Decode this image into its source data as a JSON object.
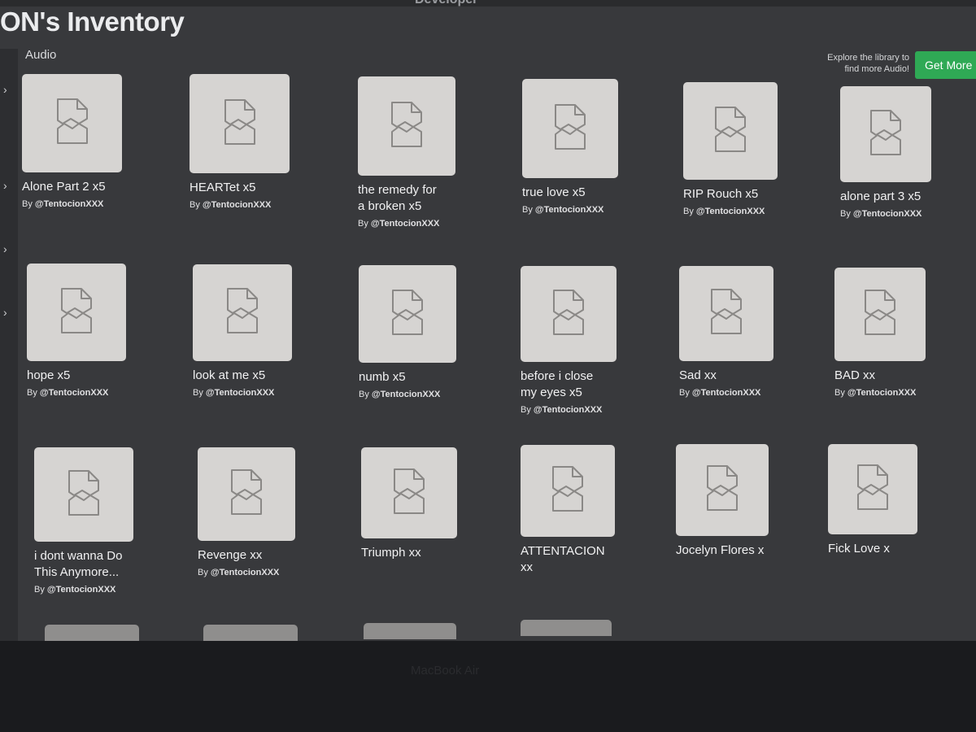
{
  "window": {
    "title_partial": "Developer"
  },
  "page": {
    "title": "ON's Inventory",
    "section": "Audio"
  },
  "promo": {
    "text": "Explore the library to find more Audio!",
    "button_label": "Get More"
  },
  "by_prefix": "By",
  "items": [
    {
      "name": "Alone Part 2 x5",
      "creator": "@TentocionXXX"
    },
    {
      "name": "HEARTet x5",
      "creator": "@TentocionXXX"
    },
    {
      "name": "the remedy for\na broken x5",
      "creator": "@TentocionXXX"
    },
    {
      "name": "true love x5",
      "creator": "@TentocionXXX"
    },
    {
      "name": "RIP Rouch x5",
      "creator": "@TentocionXXX"
    },
    {
      "name": "alone part 3 x5",
      "creator": "@TentocionXXX"
    },
    {
      "name": "hope x5",
      "creator": "@TentocionXXX"
    },
    {
      "name": "look at me x5",
      "creator": "@TentocionXXX"
    },
    {
      "name": "numb x5",
      "creator": "@TentocionXXX"
    },
    {
      "name": "before i close\nmy eyes x5",
      "creator": "@TentocionXXX"
    },
    {
      "name": "Sad xx",
      "creator": "@TentocionXXX"
    },
    {
      "name": "BAD xx",
      "creator": "@TentocionXXX"
    },
    {
      "name": "i dont wanna Do\nThis Anymore...",
      "creator": "@TentocionXXX"
    },
    {
      "name": "Revenge xx",
      "creator": "@TentocionXXX"
    },
    {
      "name": "Triumph xx",
      "creator": ""
    },
    {
      "name": "ATTENTACION\nxx",
      "creator": ""
    },
    {
      "name": "Jocelyn Flores x",
      "creator": ""
    },
    {
      "name": "Fick Love x",
      "creator": ""
    }
  ],
  "device_label": "MacBook Air",
  "colors": {
    "accent": "#2fa955",
    "background": "#38393c",
    "thumbnail": "#d6d4d2"
  },
  "icons": {
    "item_thumbnail": "broken-file-icon",
    "sidebar": "chevron-right-icon"
  }
}
